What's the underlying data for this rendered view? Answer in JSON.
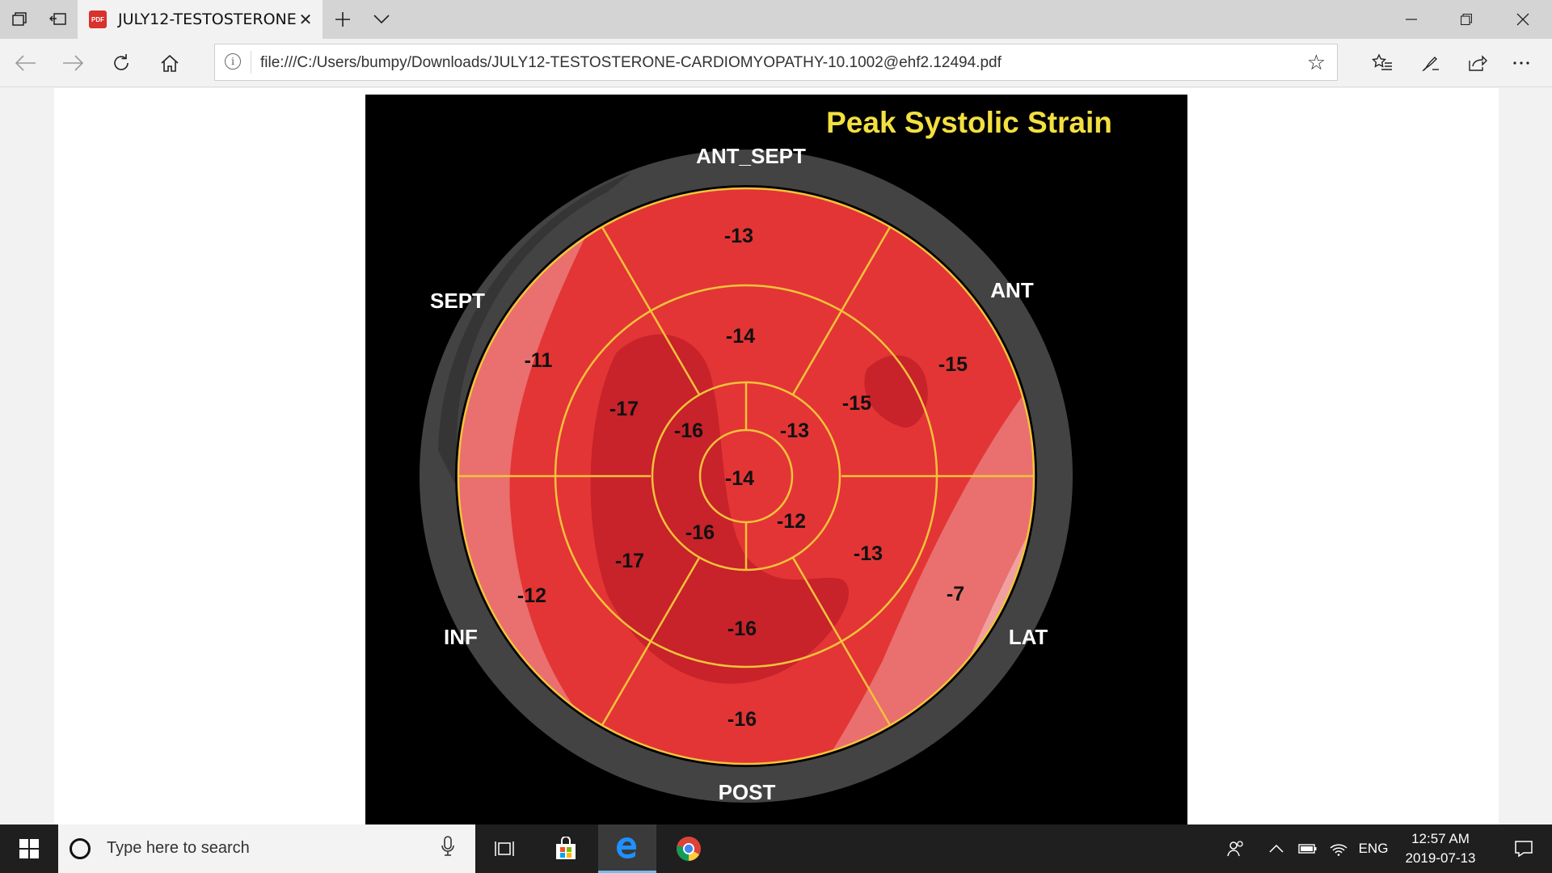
{
  "browser": {
    "tab": {
      "icon_label": "PDF",
      "title": "JULY12-TESTOSTERONE"
    },
    "address": {
      "url": "file:///C:/Users/bumpy/Downloads/JULY12-TESTOSTERONE-CARDIOMYOPATHY-10.1002@ehf2.12494.pdf"
    }
  },
  "figure": {
    "title": "Peak Systolic Strain",
    "wall_labels": {
      "ant_sept": "ANT_SEPT",
      "ant": "ANT",
      "lat": "LAT",
      "post": "POST",
      "inf": "INF",
      "sept": "SEPT"
    },
    "segments": {
      "basal_ant_sept": "-13",
      "basal_ant": "-15",
      "basal_lat": "-7",
      "basal_post": "-16",
      "basal_inf": "-12",
      "basal_sept": "-11",
      "mid_ant_sept": "-14",
      "mid_ant": "-15",
      "mid_lat": "-13",
      "mid_post": "-16",
      "mid_inf": "-17",
      "mid_sept": "-17",
      "apical_ant": "-13",
      "apical_lat": "-12",
      "apical_inf": "-16",
      "apical_sept": "-16",
      "apex": "-14"
    }
  },
  "taskbar": {
    "search_placeholder": "Type here to search",
    "language": "ENG",
    "time": "12:57 AM",
    "date": "2019-07-13"
  }
}
